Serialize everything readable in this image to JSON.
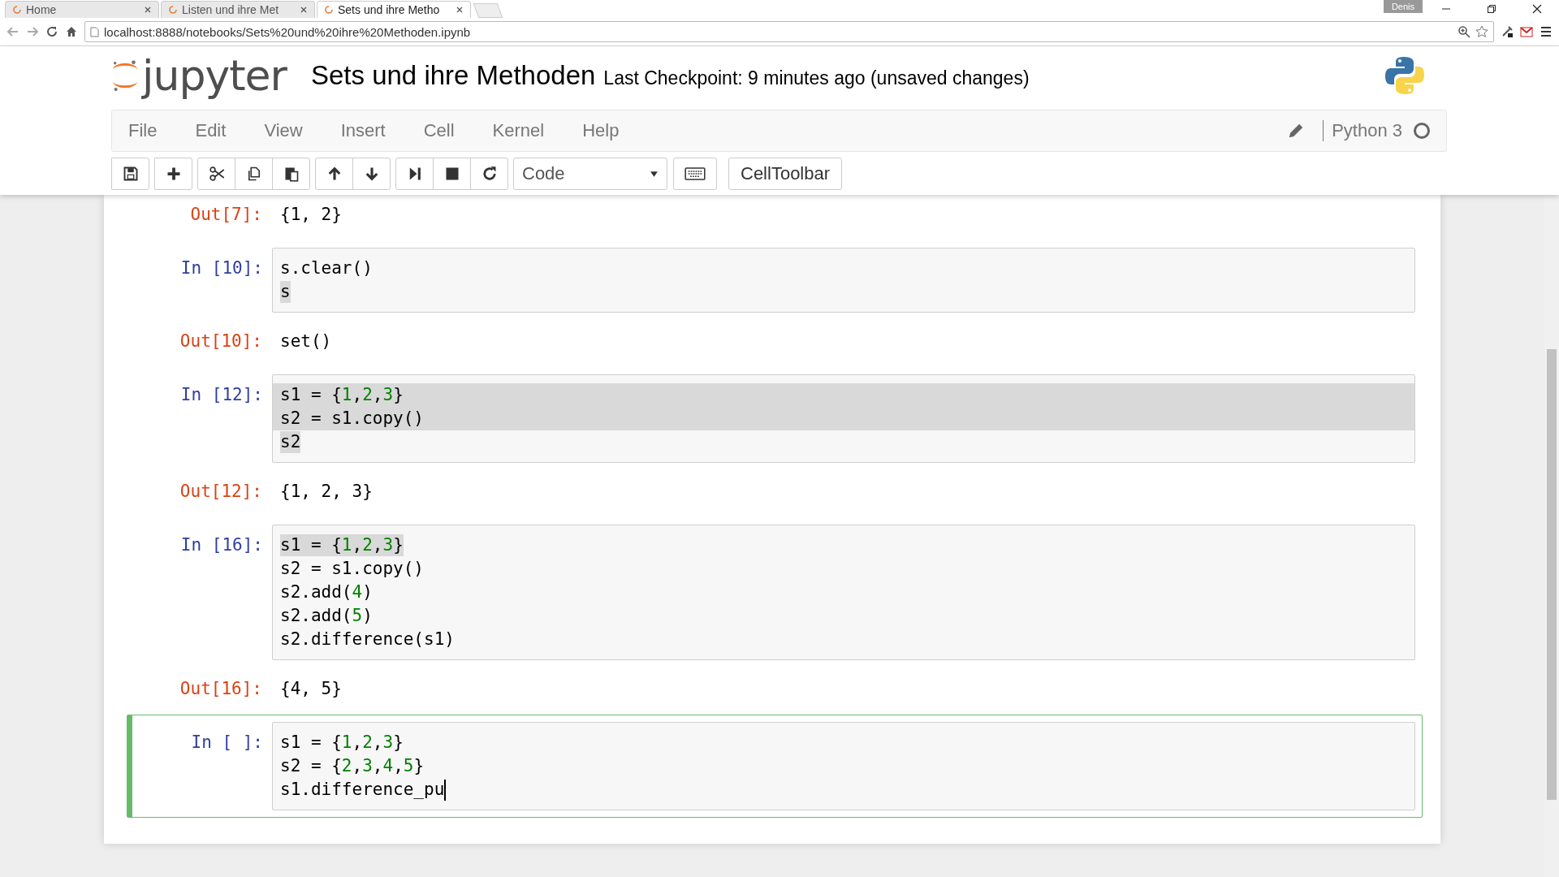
{
  "browser": {
    "tabs": [
      {
        "title": "Home",
        "selected": false
      },
      {
        "title": "Listen und ihre Met",
        "selected": false
      },
      {
        "title": "Sets und ihre Metho",
        "selected": true
      }
    ],
    "profile": "Denis",
    "url": "localhost:8888/notebooks/Sets%20und%20ihre%20Methoden.ipynb"
  },
  "header": {
    "logo": "jupyter",
    "notebook_name": "Sets und ihre Methoden",
    "checkpoint": "Last Checkpoint: 9 minutes ago (unsaved changes)"
  },
  "menu": [
    "File",
    "Edit",
    "View",
    "Insert",
    "Cell",
    "Kernel",
    "Help"
  ],
  "kernel": {
    "name": "Python 3",
    "busy": false
  },
  "toolbar": {
    "cell_type": "Code",
    "cell_toolbar": "CellToolbar"
  },
  "cells": [
    {
      "kind": "output",
      "prompt": "Out[7]:",
      "text": "{1, 2}"
    },
    {
      "kind": "input",
      "prompt": "In [10]:",
      "selected": false,
      "lines": [
        {
          "highlighted": false,
          "whole_line": false,
          "cursor": false,
          "tokens": [
            {
              "kind": "plain",
              "text": "s.clear()"
            }
          ]
        },
        {
          "highlighted": true,
          "whole_line": false,
          "cursor": false,
          "tokens": [
            {
              "kind": "plain",
              "text": "s"
            }
          ]
        }
      ]
    },
    {
      "kind": "output",
      "prompt": "Out[10]:",
      "text": "set()"
    },
    {
      "kind": "input",
      "prompt": "In [12]:",
      "selected": false,
      "lines": [
        {
          "highlighted": true,
          "whole_line": true,
          "cursor": false,
          "tokens": [
            {
              "kind": "plain",
              "text": "s1 = {"
            },
            {
              "kind": "number",
              "text": "1"
            },
            {
              "kind": "plain",
              "text": ","
            },
            {
              "kind": "number",
              "text": "2"
            },
            {
              "kind": "plain",
              "text": ","
            },
            {
              "kind": "number",
              "text": "3"
            },
            {
              "kind": "plain",
              "text": "}"
            }
          ]
        },
        {
          "highlighted": true,
          "whole_line": true,
          "cursor": false,
          "tokens": [
            {
              "kind": "plain",
              "text": "s2 = s1.copy()"
            }
          ]
        },
        {
          "highlighted": true,
          "whole_line": false,
          "cursor": false,
          "tokens": [
            {
              "kind": "plain",
              "text": "s2"
            }
          ]
        }
      ]
    },
    {
      "kind": "output",
      "prompt": "Out[12]:",
      "text": "{1, 2, 3}"
    },
    {
      "kind": "input",
      "prompt": "In [16]:",
      "selected": false,
      "lines": [
        {
          "highlighted": true,
          "whole_line": false,
          "cursor": false,
          "tokens": [
            {
              "kind": "plain",
              "text": "s1 = {"
            },
            {
              "kind": "number",
              "text": "1"
            },
            {
              "kind": "plain",
              "text": ","
            },
            {
              "kind": "number",
              "text": "2"
            },
            {
              "kind": "plain",
              "text": ","
            },
            {
              "kind": "number",
              "text": "3"
            },
            {
              "kind": "plain",
              "text": "}"
            }
          ]
        },
        {
          "highlighted": false,
          "whole_line": false,
          "cursor": false,
          "tokens": [
            {
              "kind": "plain",
              "text": "s2 = s1.copy()"
            }
          ]
        },
        {
          "highlighted": false,
          "whole_line": false,
          "cursor": false,
          "tokens": [
            {
              "kind": "plain",
              "text": "s2.add("
            },
            {
              "kind": "number",
              "text": "4"
            },
            {
              "kind": "plain",
              "text": ")"
            }
          ]
        },
        {
          "highlighted": false,
          "whole_line": false,
          "cursor": false,
          "tokens": [
            {
              "kind": "plain",
              "text": "s2.add("
            },
            {
              "kind": "number",
              "text": "5"
            },
            {
              "kind": "plain",
              "text": ")"
            }
          ]
        },
        {
          "highlighted": false,
          "whole_line": false,
          "cursor": false,
          "tokens": [
            {
              "kind": "plain",
              "text": "s2.difference(s1)"
            }
          ]
        }
      ]
    },
    {
      "kind": "output",
      "prompt": "Out[16]:",
      "text": "{4, 5}"
    },
    {
      "kind": "input",
      "prompt": "In [ ]:",
      "selected": true,
      "lines": [
        {
          "highlighted": false,
          "whole_line": false,
          "cursor": false,
          "tokens": [
            {
              "kind": "plain",
              "text": "s1 = {"
            },
            {
              "kind": "number",
              "text": "1"
            },
            {
              "kind": "plain",
              "text": ","
            },
            {
              "kind": "number",
              "text": "2"
            },
            {
              "kind": "plain",
              "text": ","
            },
            {
              "kind": "number",
              "text": "3"
            },
            {
              "kind": "plain",
              "text": "}"
            }
          ]
        },
        {
          "highlighted": false,
          "whole_line": false,
          "cursor": false,
          "tokens": [
            {
              "kind": "plain",
              "text": "s2 = {"
            },
            {
              "kind": "number",
              "text": "2"
            },
            {
              "kind": "plain",
              "text": ","
            },
            {
              "kind": "number",
              "text": "3"
            },
            {
              "kind": "plain",
              "text": ","
            },
            {
              "kind": "number",
              "text": "4"
            },
            {
              "kind": "plain",
              "text": ","
            },
            {
              "kind": "number",
              "text": "5"
            },
            {
              "kind": "plain",
              "text": "}"
            }
          ]
        },
        {
          "highlighted": false,
          "whole_line": false,
          "cursor": true,
          "tokens": [
            {
              "kind": "plain",
              "text": "s1.difference_pu"
            }
          ]
        }
      ]
    }
  ]
}
